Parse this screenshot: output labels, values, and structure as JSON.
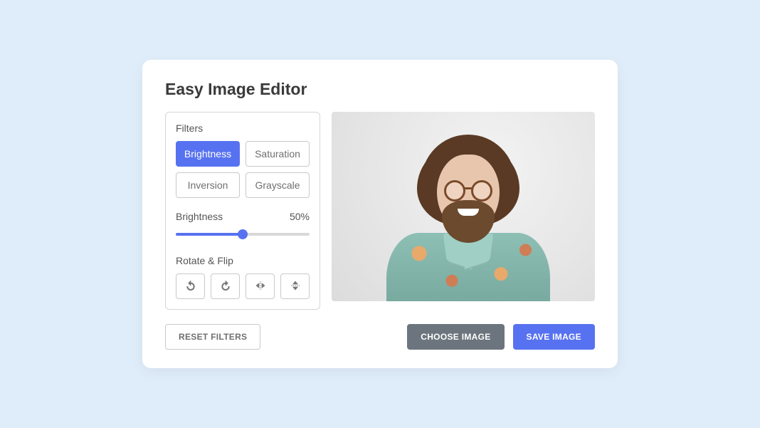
{
  "title": "Easy Image Editor",
  "filters": {
    "section_label": "Filters",
    "buttons": {
      "brightness": "Brightness",
      "saturation": "Saturation",
      "inversion": "Inversion",
      "grayscale": "Grayscale"
    },
    "active": "brightness",
    "slider": {
      "name_label": "Brightness",
      "value_label": "50%",
      "value": 50,
      "min": 0,
      "max": 100
    }
  },
  "rotate": {
    "section_label": "Rotate & Flip",
    "icons": {
      "rotate_left": "rotate-left-icon",
      "rotate_right": "rotate-right-icon",
      "flip_horizontal": "flip-horizontal-icon",
      "flip_vertical": "flip-vertical-icon"
    }
  },
  "footer": {
    "reset_label": "RESET FILTERS",
    "choose_label": "CHOOSE IMAGE",
    "save_label": "SAVE IMAGE"
  },
  "colors": {
    "accent": "#5772f0",
    "page_bg": "#dfecf9",
    "gray_btn": "#6c757d"
  }
}
